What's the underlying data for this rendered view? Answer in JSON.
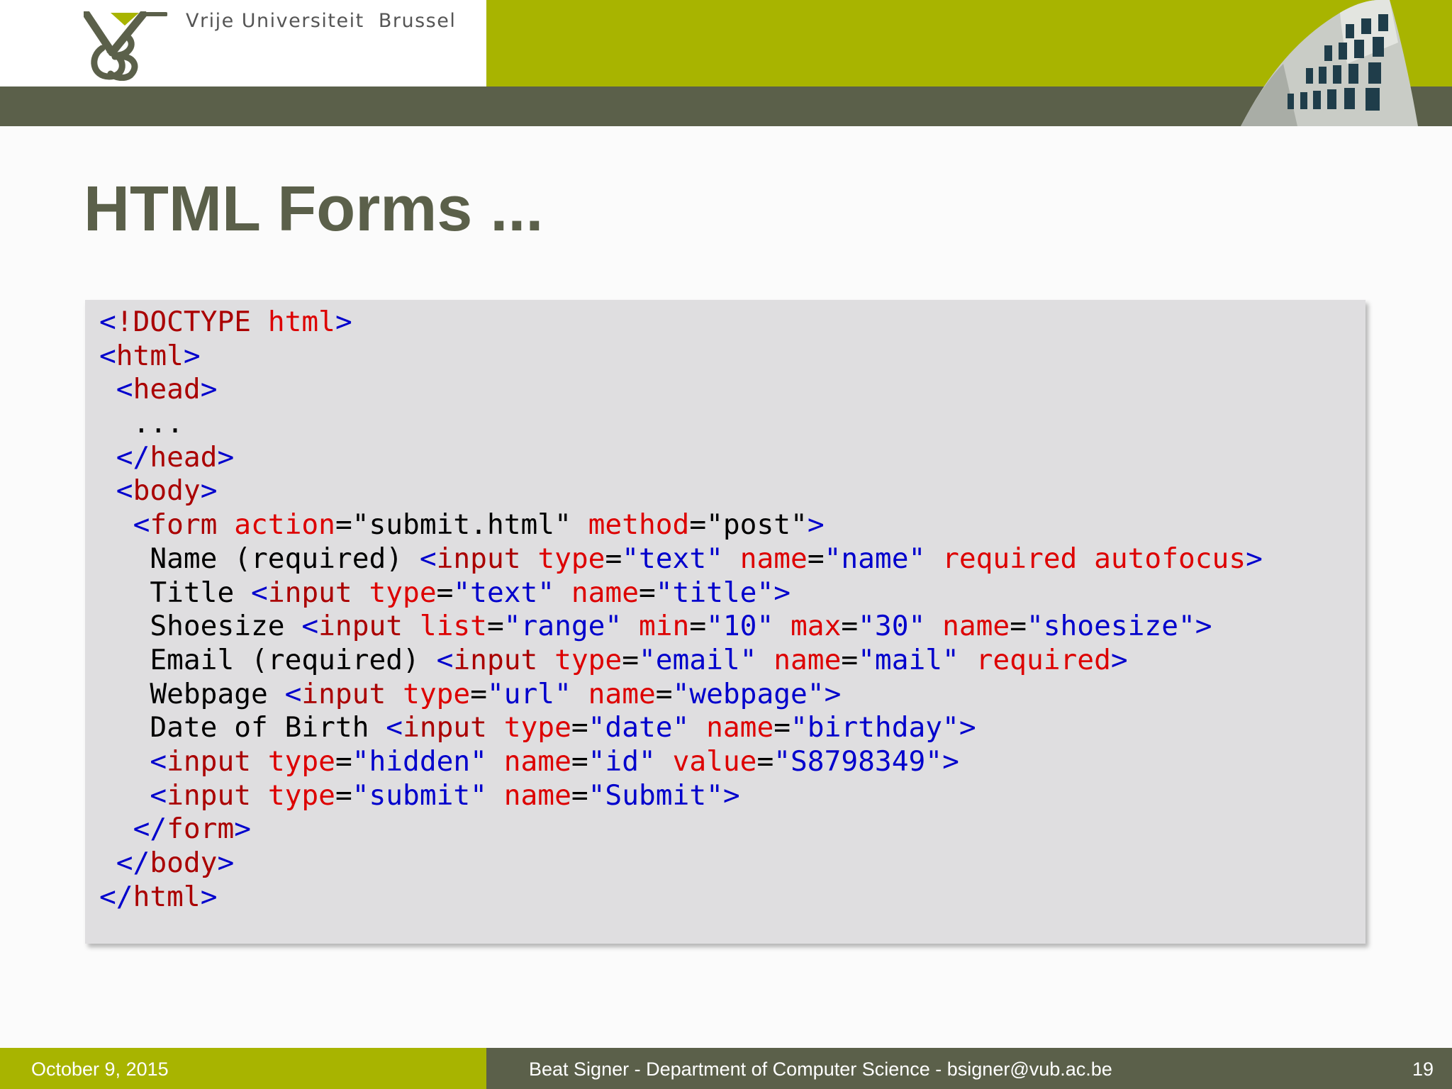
{
  "header": {
    "university": "Vrije Universiteit  Brussel",
    "colors": {
      "green": "#a8b400",
      "olive": "#5b604a"
    }
  },
  "title": "HTML Forms ...",
  "code": {
    "lines": [
      [
        [
          "punct",
          "<"
        ],
        [
          "tag",
          "!DOCTYPE "
        ],
        [
          "attr",
          "html"
        ],
        [
          "punct",
          ">"
        ]
      ],
      [
        [
          "punct",
          "<"
        ],
        [
          "tag",
          "html"
        ],
        [
          "punct",
          ">"
        ]
      ],
      [
        [
          "text",
          " "
        ],
        [
          "punct",
          "<"
        ],
        [
          "tag",
          "head"
        ],
        [
          "punct",
          ">"
        ]
      ],
      [
        [
          "text",
          "  ..."
        ]
      ],
      [
        [
          "text",
          " "
        ],
        [
          "punct",
          "</"
        ],
        [
          "tag",
          "head"
        ],
        [
          "punct",
          ">"
        ]
      ],
      [
        [
          "text",
          " "
        ],
        [
          "punct",
          "<"
        ],
        [
          "tag",
          "body"
        ],
        [
          "punct",
          ">"
        ]
      ],
      [
        [
          "text",
          "  "
        ],
        [
          "punct",
          "<"
        ],
        [
          "tag",
          "form"
        ],
        [
          "text",
          " "
        ],
        [
          "attr",
          "action"
        ],
        [
          "text",
          "=\"submit.html\" "
        ],
        [
          "attr",
          "method"
        ],
        [
          "text",
          "=\"post\""
        ],
        [
          "punct",
          ">"
        ]
      ],
      [
        [
          "text",
          "   Name (required) "
        ],
        [
          "punct",
          "<"
        ],
        [
          "tag",
          "input"
        ],
        [
          "text",
          " "
        ],
        [
          "attr",
          "type"
        ],
        [
          "text",
          "="
        ],
        [
          "val",
          "\"text\""
        ],
        [
          "text",
          " "
        ],
        [
          "attr",
          "name"
        ],
        [
          "text",
          "="
        ],
        [
          "val",
          "\"name\""
        ],
        [
          "text",
          " "
        ],
        [
          "attr",
          "required autofocus"
        ],
        [
          "punct",
          ">"
        ]
      ],
      [
        [
          "text",
          "   Title "
        ],
        [
          "punct",
          "<"
        ],
        [
          "tag",
          "input"
        ],
        [
          "text",
          " "
        ],
        [
          "attr",
          "type"
        ],
        [
          "text",
          "="
        ],
        [
          "val",
          "\"text\""
        ],
        [
          "text",
          " "
        ],
        [
          "attr",
          "name"
        ],
        [
          "text",
          "="
        ],
        [
          "val",
          "\"title\""
        ],
        [
          "punct",
          ">"
        ]
      ],
      [
        [
          "text",
          "   Shoesize "
        ],
        [
          "punct",
          "<"
        ],
        [
          "tag",
          "input"
        ],
        [
          "text",
          " "
        ],
        [
          "attr",
          "list"
        ],
        [
          "text",
          "="
        ],
        [
          "val",
          "\"range\""
        ],
        [
          "text",
          " "
        ],
        [
          "attr",
          "min"
        ],
        [
          "text",
          "="
        ],
        [
          "val",
          "\"10\""
        ],
        [
          "text",
          " "
        ],
        [
          "attr",
          "max"
        ],
        [
          "text",
          "="
        ],
        [
          "val",
          "\"30\""
        ],
        [
          "text",
          " "
        ],
        [
          "attr",
          "name"
        ],
        [
          "text",
          "="
        ],
        [
          "val",
          "\"shoesize\""
        ],
        [
          "punct",
          ">"
        ]
      ],
      [
        [
          "text",
          "   Email (required) "
        ],
        [
          "punct",
          "<"
        ],
        [
          "tag",
          "input"
        ],
        [
          "text",
          " "
        ],
        [
          "attr",
          "type"
        ],
        [
          "text",
          "="
        ],
        [
          "val",
          "\"email\""
        ],
        [
          "text",
          " "
        ],
        [
          "attr",
          "name"
        ],
        [
          "text",
          "="
        ],
        [
          "val",
          "\"mail\""
        ],
        [
          "text",
          " "
        ],
        [
          "attr",
          "required"
        ],
        [
          "punct",
          ">"
        ]
      ],
      [
        [
          "text",
          "   Webpage "
        ],
        [
          "punct",
          "<"
        ],
        [
          "tag",
          "input"
        ],
        [
          "text",
          " "
        ],
        [
          "attr",
          "type"
        ],
        [
          "text",
          "="
        ],
        [
          "val",
          "\"url\""
        ],
        [
          "text",
          " "
        ],
        [
          "attr",
          "name"
        ],
        [
          "text",
          "="
        ],
        [
          "val",
          "\"webpage\""
        ],
        [
          "punct",
          ">"
        ]
      ],
      [
        [
          "text",
          "   Date of Birth "
        ],
        [
          "punct",
          "<"
        ],
        [
          "tag",
          "input"
        ],
        [
          "text",
          " "
        ],
        [
          "attr",
          "type"
        ],
        [
          "text",
          "="
        ],
        [
          "val",
          "\"date\""
        ],
        [
          "text",
          " "
        ],
        [
          "attr",
          "name"
        ],
        [
          "text",
          "="
        ],
        [
          "val",
          "\"birthday\""
        ],
        [
          "punct",
          ">"
        ]
      ],
      [
        [
          "text",
          "   "
        ],
        [
          "punct",
          "<"
        ],
        [
          "tag",
          "input"
        ],
        [
          "text",
          " "
        ],
        [
          "attr",
          "type"
        ],
        [
          "text",
          "="
        ],
        [
          "val",
          "\"hidden\""
        ],
        [
          "text",
          " "
        ],
        [
          "attr",
          "name"
        ],
        [
          "text",
          "="
        ],
        [
          "val",
          "\"id\""
        ],
        [
          "text",
          " "
        ],
        [
          "attr",
          "value"
        ],
        [
          "text",
          "="
        ],
        [
          "val",
          "\"S8798349\""
        ],
        [
          "punct",
          ">"
        ]
      ],
      [
        [
          "text",
          "   "
        ],
        [
          "punct",
          "<"
        ],
        [
          "tag",
          "input"
        ],
        [
          "text",
          " "
        ],
        [
          "attr",
          "type"
        ],
        [
          "text",
          "="
        ],
        [
          "val",
          "\"submit\""
        ],
        [
          "text",
          " "
        ],
        [
          "attr",
          "name"
        ],
        [
          "text",
          "="
        ],
        [
          "val",
          "\"Submit\""
        ],
        [
          "punct",
          ">"
        ]
      ],
      [
        [
          "text",
          "  "
        ],
        [
          "punct",
          "</"
        ],
        [
          "tag",
          "form"
        ],
        [
          "punct",
          ">"
        ]
      ],
      [
        [
          "text",
          " "
        ],
        [
          "punct",
          "</"
        ],
        [
          "tag",
          "body"
        ],
        [
          "punct",
          ">"
        ]
      ],
      [
        [
          "punct",
          "</"
        ],
        [
          "tag",
          "html"
        ],
        [
          "punct",
          ">"
        ]
      ]
    ]
  },
  "footer": {
    "date": "October 9, 2015",
    "author": "Beat Signer - Department of Computer Science - bsigner@vub.ac.be",
    "page": "19"
  }
}
